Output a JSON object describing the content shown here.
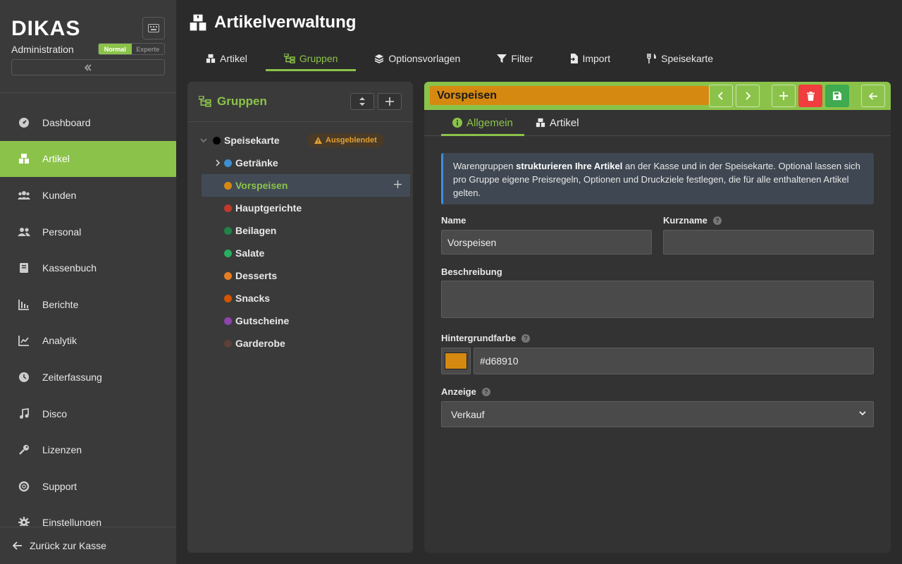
{
  "sidebar": {
    "brand": "DIKAS",
    "subtitle": "Administration",
    "mode_normal": "Normal",
    "mode_expert": "Experte",
    "items": [
      {
        "label": "Dashboard",
        "icon": "gauge-icon"
      },
      {
        "label": "Artikel",
        "icon": "boxes-icon",
        "active": true
      },
      {
        "label": "Kunden",
        "icon": "users-icon"
      },
      {
        "label": "Personal",
        "icon": "user-group-icon"
      },
      {
        "label": "Kassenbuch",
        "icon": "book-icon"
      },
      {
        "label": "Berichte",
        "icon": "bar-chart-icon"
      },
      {
        "label": "Analytik",
        "icon": "line-chart-icon"
      },
      {
        "label": "Zeiterfassung",
        "icon": "clock-icon"
      },
      {
        "label": "Disco",
        "icon": "music-icon"
      },
      {
        "label": "Lizenzen",
        "icon": "key-icon"
      },
      {
        "label": "Support",
        "icon": "lifebuoy-icon"
      },
      {
        "label": "Einstellungen",
        "icon": "gear-icon"
      }
    ],
    "back_label": "Zurück zur Kasse"
  },
  "header": {
    "title": "Artikelverwaltung",
    "tabs": [
      {
        "label": "Artikel",
        "icon": "boxes-icon"
      },
      {
        "label": "Gruppen",
        "icon": "sitemap-icon",
        "active": true
      },
      {
        "label": "Optionsvorlagen",
        "icon": "layers-icon"
      },
      {
        "label": "Filter",
        "icon": "filter-icon"
      },
      {
        "label": "Import",
        "icon": "file-import-icon"
      },
      {
        "label": "Speisekarte",
        "icon": "utensils-icon"
      }
    ]
  },
  "tree": {
    "title": "Gruppen",
    "root": {
      "label": "Speisekarte",
      "color": "#000000",
      "badge": "Ausgeblendet"
    },
    "groups": [
      {
        "label": "Getränke",
        "color": "#3d8fd0",
        "expandable": true
      },
      {
        "label": "Vorspeisen",
        "color": "#d68910",
        "selected": true
      },
      {
        "label": "Hauptgerichte",
        "color": "#c0392b"
      },
      {
        "label": "Beilagen",
        "color": "#1e8449"
      },
      {
        "label": "Salate",
        "color": "#27ae60"
      },
      {
        "label": "Desserts",
        "color": "#e67e22"
      },
      {
        "label": "Snacks",
        "color": "#d35400"
      },
      {
        "label": "Gutscheine",
        "color": "#8e44ad"
      },
      {
        "label": "Garderobe",
        "color": "#5d4037"
      }
    ]
  },
  "detail": {
    "name": "Vorspeisen",
    "name_color": "#d68910",
    "tabs": [
      {
        "label": "Allgemein",
        "icon": "info-icon",
        "active": true
      },
      {
        "label": "Artikel",
        "icon": "boxes-icon"
      }
    ],
    "info_pre": "Warengruppen ",
    "info_bold": "strukturieren Ihre Artikel",
    "info_post": " an der Kasse und in der Speisekarte. Optional lassen sich pro Gruppe eigene Preisregeln, Optionen und Druckziele festlegen, die für alle enthaltenen Artikel gelten.",
    "fields": {
      "name_label": "Name",
      "name_value": "Vorspeisen",
      "short_label": "Kurzname",
      "short_value": "",
      "desc_label": "Beschreibung",
      "desc_value": "",
      "bg_label": "Hintergrundfarbe",
      "bg_value": "#d68910",
      "display_label": "Anzeige",
      "display_value": "Verkauf"
    }
  }
}
